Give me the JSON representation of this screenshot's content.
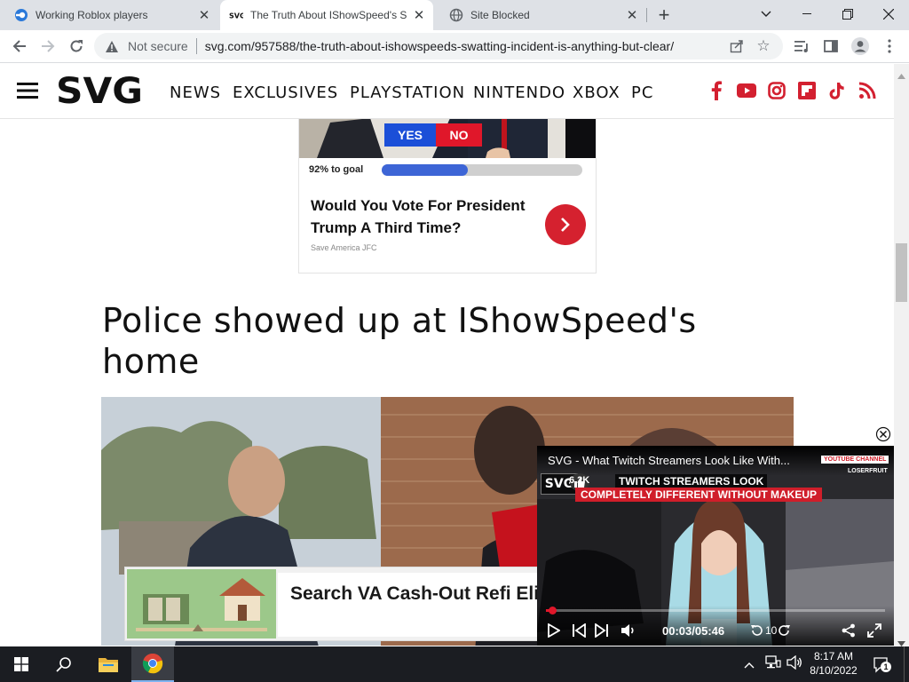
{
  "tabs": [
    {
      "title": "Working Roblox players",
      "favicon": "roblox-tab-icon",
      "active": false
    },
    {
      "title": "The Truth About IShowSpeed's S",
      "favicon": "svg-tab-icon",
      "active": true
    },
    {
      "title": "Site Blocked",
      "favicon": "globe-tab-icon",
      "active": false
    }
  ],
  "new_tab_symbol": "+",
  "address_bar": {
    "security_label": "Not secure",
    "url": "svg.com/957588/the-truth-about-ishowspeeds-swatting-incident-is-anything-but-clear/"
  },
  "site": {
    "logo": "SVG",
    "nav": [
      "NEWS",
      "EXCLUSIVES",
      "PLAYSTATION",
      "NINTENDO",
      "XBOX",
      "PC"
    ],
    "social_icons": [
      "facebook-icon",
      "youtube-icon",
      "instagram-icon",
      "flipboard-icon",
      "tiktok-icon",
      "rss-icon"
    ],
    "brand_color": "#d32030"
  },
  "ad_poll": {
    "yes_label": "YES",
    "no_label": "NO",
    "progress_text": "92% to goal",
    "progress_fraction": 0.43,
    "question": "Would You Vote For President Trump A Third Time?",
    "sponsor": "Save America JFC"
  },
  "article": {
    "heading": "Police showed up at IShowSpeed's home"
  },
  "bottom_ad": {
    "text": "Search VA Cash-Out Refi Eligibility - Get Cash Out of Home Equity"
  },
  "video_player": {
    "title": "SVG - What Twitch Streamers Look Like With...",
    "likes": "6.2K",
    "overlay_line1": "TWITCH STREAMERS LOOK",
    "overlay_line2": "COMPLETELY DIFFERENT WITHOUT MAKEUP",
    "channel_tag": "YOUTUBE CHANNEL",
    "channel_name": "LOSERFRUIT",
    "logo": "SVG",
    "time": "00:03/05:46",
    "skip_label": "10",
    "progress_fraction": 0.01
  },
  "taskbar": {
    "time": "8:17 AM",
    "date": "8/10/2022",
    "notification_count": "1"
  }
}
